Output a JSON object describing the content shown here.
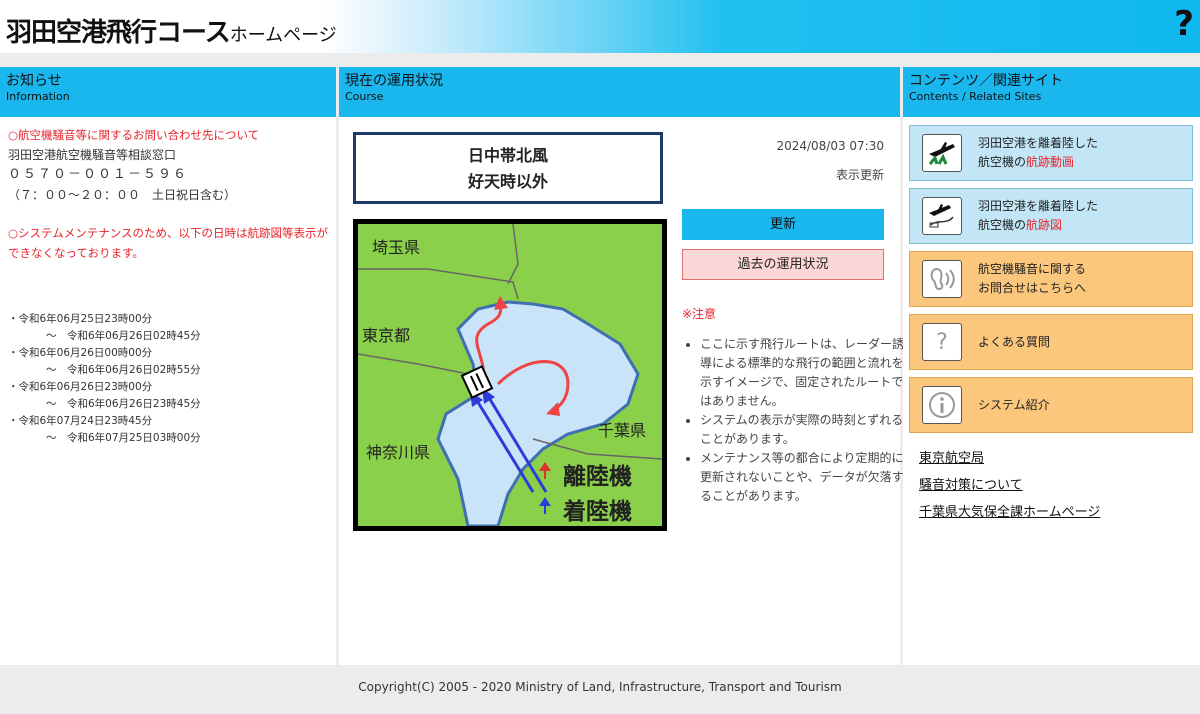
{
  "header": {
    "title": "羽田空港飛行コース",
    "subtitle": "ホームページ",
    "help_label": "?"
  },
  "left": {
    "title_ja": "お知らせ",
    "title_en": "Information",
    "notice1_title": "○航空機騒音等に関するお問い合わせ先について",
    "notice1_line1": "羽田空港航空機騒音等相談窓口",
    "notice1_phone": "０５７０－００１－５９６",
    "notice1_hours": "（７：００～２０：００　土日祝日含む）",
    "notice2_title": "○システムメンテナンスのため、以下の日時は航跡図等表示ができなくなっております。",
    "schedule": [
      {
        "from": "・令和6年06月25日23時00分",
        "to": "～　令和6年06月26日02時45分"
      },
      {
        "from": "・令和6年06月26日00時00分",
        "to": "～　令和6年06月26日02時55分"
      },
      {
        "from": "・令和6年06月26日23時00分",
        "to": "～　令和6年06月26日23時45分"
      },
      {
        "from": "・令和6年07月24日23時45分",
        "to": "～　令和6年07月25日03時00分"
      }
    ]
  },
  "middle": {
    "title_ja": "現在の運用状況",
    "title_en": "Course",
    "wind_line1": "日中帯北風",
    "wind_line2": "好天時以外",
    "timestamp": "2024/08/03 07:30",
    "refresh_label": "表示更新",
    "update_button": "更新",
    "past_button": "過去の運用状況",
    "caution_label": "※注意",
    "notes": [
      "ここに示す飛行ルートは、レーダー誘導による標準的な飛行の範囲と流れを示すイメージで、固定されたルートではありません。",
      "システムの表示が実際の時刻とずれることがあります。",
      "メンテナンス等の都合により定期的に更新されないことや、データが欠落することがあります。"
    ],
    "map": {
      "saitama": "埼玉県",
      "tokyo": "東京都",
      "kanagawa": "神奈川県",
      "chiba": "千葉県",
      "departure": "離陸機",
      "arrival": "着陸機",
      "departure_color": "#e03030",
      "arrival_color": "#2f3bd8"
    }
  },
  "right": {
    "title_ja": "コンテンツ／関連サイト",
    "title_en": "Contents / Related Sites",
    "tile1_line1": "羽田空港を離着陸した",
    "tile1_line2_a": "航空機の",
    "tile1_line2_b": "航跡動画",
    "tile2_line1": "羽田空港を離着陸した",
    "tile2_line2_a": "航空機の",
    "tile2_line2_b": "航跡図",
    "tile3_line1": "航空機騒音に関する",
    "tile3_line2": "お問合せはこちらへ",
    "tile4_label": "よくある質問",
    "tile5_label": "システム紹介",
    "links": [
      "東京航空局",
      "騒音対策について",
      "千葉県大気保全課ホームページ"
    ]
  },
  "footer": {
    "copyright": "Copyright(C) 2005 - 2020 Ministry of Land, Infrastructure, Transport and Tourism"
  }
}
